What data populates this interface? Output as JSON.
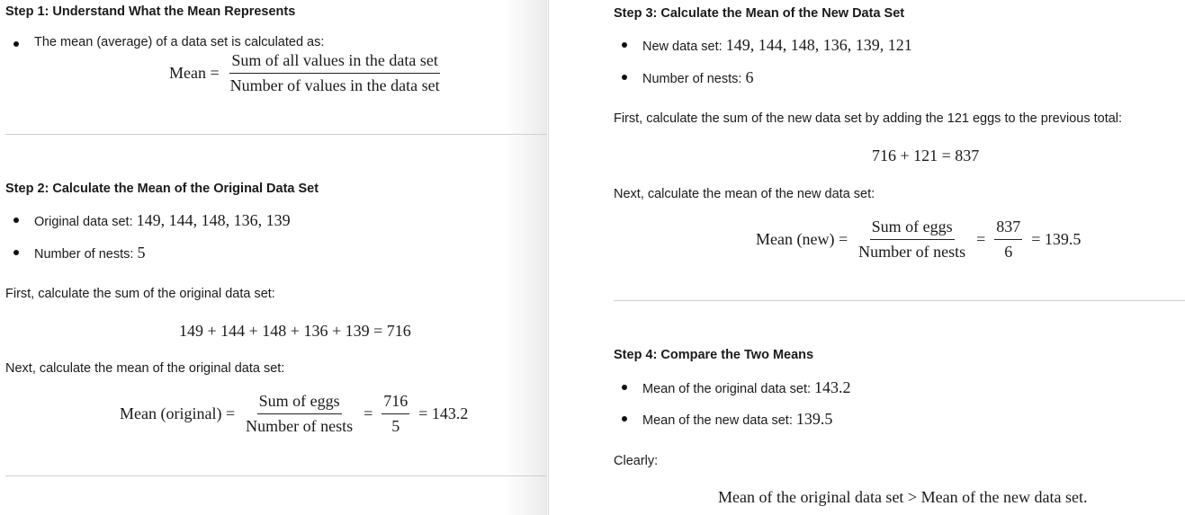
{
  "step1": {
    "heading": "Step 1: Understand What the Mean Represents",
    "bullet": "The mean (average) of a data set is calculated as:",
    "lhs": "Mean =",
    "num": "Sum of all values in the data set",
    "den": "Number of values in the data set"
  },
  "step2": {
    "heading": "Step 2: Calculate the Mean of the Original Data Set",
    "b1_label": "Original data set: ",
    "b1_math": "149, 144, 148, 136, 139",
    "b2_label": "Number of nests: ",
    "b2_math": "5",
    "first": "First, calculate the sum of the original data set:",
    "sum_eq": "149 + 144 + 148 + 136 + 139 = 716",
    "next": "Next, calculate the mean of the original data set:",
    "lhs": "Mean (original) =",
    "num": "Sum of eggs",
    "den": "Number of nests",
    "eq": "=",
    "num2": "716",
    "den2": "5",
    "result": "= 143.2"
  },
  "step3": {
    "heading": "Step 3: Calculate the Mean of the New Data Set",
    "b1_label": "New data set: ",
    "b1_math": "149, 144, 148, 136, 139, 121",
    "b2_label": "Number of nests: ",
    "b2_math": "6",
    "first": "First, calculate the sum of the new data set by adding the 121 eggs to the previous total:",
    "sum_eq": "716 + 121 = 837",
    "next": "Next, calculate the mean of the new data set:",
    "lhs": "Mean (new) =",
    "num": "Sum of eggs",
    "den": "Number of nests",
    "eq": "=",
    "num2": "837",
    "den2": "6",
    "result": "= 139.5"
  },
  "step4": {
    "heading": "Step 4: Compare the Two Means",
    "b1_label": "Mean of the original data set: ",
    "b1_math": "143.2",
    "b2_label": "Mean of the new data set: ",
    "b2_math": "139.5",
    "clearly": "Clearly:",
    "final": "Mean of the original data set > Mean of the new data set."
  }
}
